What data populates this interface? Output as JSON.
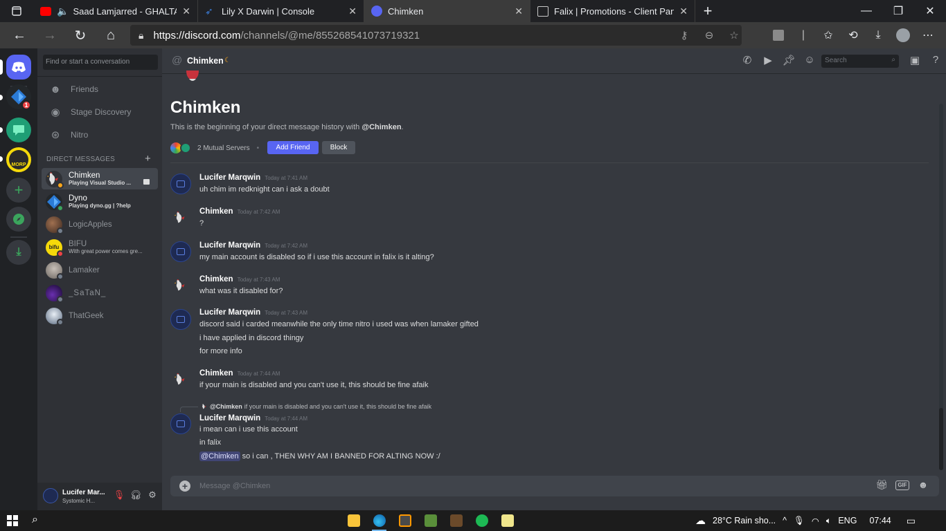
{
  "browser": {
    "tabs": [
      {
        "title": "Saad Lamjarred - GHALTANA",
        "close": "✕"
      },
      {
        "title": "Lily X Darwin | Console",
        "close": "✕"
      },
      {
        "title": "Chimken",
        "close": "✕"
      },
      {
        "title": "Falix | Promotions - Client Panel",
        "close": "✕"
      }
    ],
    "url_host": "https://discord.com",
    "url_path": "/channels/@me/855268541073719321"
  },
  "guilds": {
    "badge": "1"
  },
  "sidebar": {
    "search_placeholder": "Find or start a conversation",
    "nav": [
      {
        "label": "Friends",
        "icon": "friends-icon"
      },
      {
        "label": "Stage Discovery",
        "icon": "stage-icon"
      },
      {
        "label": "Nitro",
        "icon": "nitro-icon"
      }
    ],
    "dm_header": "DIRECT MESSAGES",
    "dms": [
      {
        "name": "Chimken",
        "sub": "Playing Visual Studio ...",
        "status": "#faa61a"
      },
      {
        "name": "Dyno",
        "sub": "Playing dyno.gg | ?help",
        "status": "#3ba55d"
      },
      {
        "name": "LogicApples",
        "sub": "",
        "status": "#747f8d"
      },
      {
        "name": "BIFU",
        "sub": "With great power comes gre...",
        "status": "#ed4245"
      },
      {
        "name": "Lamaker",
        "sub": "",
        "status": "#747f8d"
      },
      {
        "name": "_SaTaN_",
        "sub": "",
        "status": "#747f8d"
      },
      {
        "name": "ThatGeek",
        "sub": "",
        "status": "#747f8d"
      }
    ]
  },
  "user_panel": {
    "name": "Lucifer Mar...",
    "sub": "Systomic H..."
  },
  "chat": {
    "header_name": "Chimken",
    "search_placeholder": "Search",
    "intro_title": "Chimken",
    "intro_text_pre": "This is the beginning of your direct message history with ",
    "intro_mention": "@Chimken",
    "intro_text_post": ".",
    "mutual_servers": "2 Mutual Servers",
    "add_friend": "Add Friend",
    "block": "Block",
    "messages": [
      {
        "author": "Lucifer  Marqwin",
        "time": "Today at 7:41 AM",
        "lines": [
          "uh chim im redknight can i ask a doubt"
        ]
      },
      {
        "author": "Chimken",
        "time": "Today at 7:42 AM",
        "lines": [
          "?"
        ]
      },
      {
        "author": "Lucifer  Marqwin",
        "time": "Today at 7:42 AM",
        "lines": [
          "my main account is disabled so if i use this account in falix is it alting?"
        ]
      },
      {
        "author": "Chimken",
        "time": "Today at 7:43 AM",
        "lines": [
          "what was it disabled for?"
        ]
      },
      {
        "author": "Lucifer  Marqwin",
        "time": "Today at 7:43 AM",
        "lines": [
          "discord said i carded meanwhile the only time nitro i used was when lamaker gifted",
          "i have applied in discord thingy",
          "for more info"
        ]
      },
      {
        "author": "Chimken",
        "time": "Today at 7:44 AM",
        "lines": [
          "if your main is disabled and you can't use it, this should be fine afaik"
        ]
      },
      {
        "author": "Lucifer  Marqwin",
        "time": "Today at 7:44 AM",
        "lines": [
          "i mean can i use this account",
          "in falix"
        ]
      }
    ],
    "reply_mention": "@Chimken",
    "reply_text": "if your main is disabled and you can't use it, this should be fine afaik",
    "last_mention": "@Chimken",
    "last_text": " so i can ,  THEN WHY AM I BANNED FOR ALTING NOW :/",
    "composer_placeholder": "Message @Chimken",
    "gif_label": "GIF"
  },
  "taskbar": {
    "weather": "28°C  Rain sho...",
    "language": "ENG",
    "time": "07:44"
  }
}
